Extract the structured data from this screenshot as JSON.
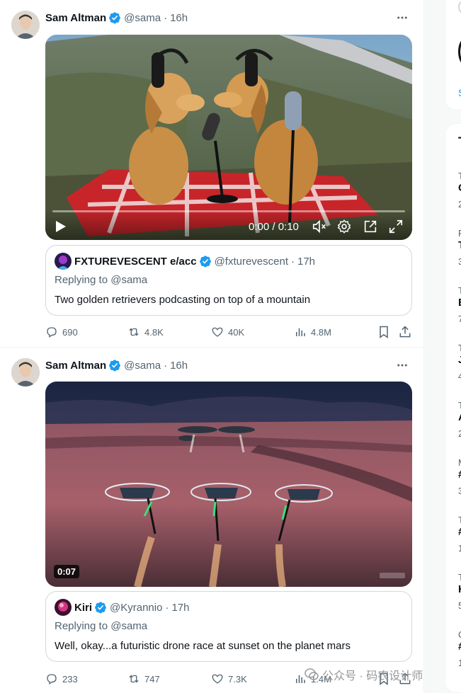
{
  "tweets": [
    {
      "author": "Sam Altman",
      "handle": "@sama",
      "time": "16h",
      "video": {
        "current_time": "0:00 / 0:10",
        "progress": 0.0,
        "controls": [
          "play-icon",
          "volume-muted-icon",
          "settings-gear-icon",
          "popout-icon",
          "fullscreen-icon"
        ]
      },
      "quote": {
        "author": "FXTUREVESCENT e/acc",
        "handle": "@fxturevescent",
        "time": "17h",
        "replying_prefix": "Replying to ",
        "replying_to": "@sama",
        "text": "Two golden retrievers podcasting on top of a mountain"
      },
      "actions": {
        "replies": "690",
        "reposts": "4.8K",
        "likes": "40K",
        "views": "4.8M"
      }
    },
    {
      "author": "Sam Altman",
      "handle": "@sama",
      "time": "16h",
      "video": {
        "duration_badge": "0:07"
      },
      "quote": {
        "author": "Kiri",
        "handle": "@Kyrannio",
        "time": "17h",
        "replying_prefix": "Replying to ",
        "replying_to": "@sama",
        "text": "Well, okay...a futuristic drone race at sunset on the planet mars"
      },
      "actions": {
        "replies": "233",
        "reposts": "747",
        "likes": "7.3K",
        "views": "1.4M"
      }
    }
  ],
  "sidebar": {
    "search_link_fragment": "S",
    "trends_title_fragment": "T",
    "trends": [
      {
        "category": "T",
        "name": "C",
        "count": "2"
      },
      {
        "category": "F",
        "name": "T",
        "count": "3"
      },
      {
        "category": "T",
        "name": "E",
        "count": "7"
      },
      {
        "category": "T",
        "name": "J",
        "count": "4"
      },
      {
        "category": "T",
        "name": "A",
        "count": "2"
      },
      {
        "category": "M",
        "name": "#",
        "count": "3"
      },
      {
        "category": "T",
        "name": "#",
        "count": "1"
      },
      {
        "category": "T",
        "name": "K",
        "count": "5"
      },
      {
        "category": "C",
        "name": "#",
        "count": "1"
      }
    ]
  },
  "watermark": {
    "text": "公众号 · 码农设计师"
  },
  "colors": {
    "verified": "#1d9bf0",
    "text_primary": "#0f1419",
    "text_secondary": "#536471",
    "border": "#cfd9de"
  }
}
